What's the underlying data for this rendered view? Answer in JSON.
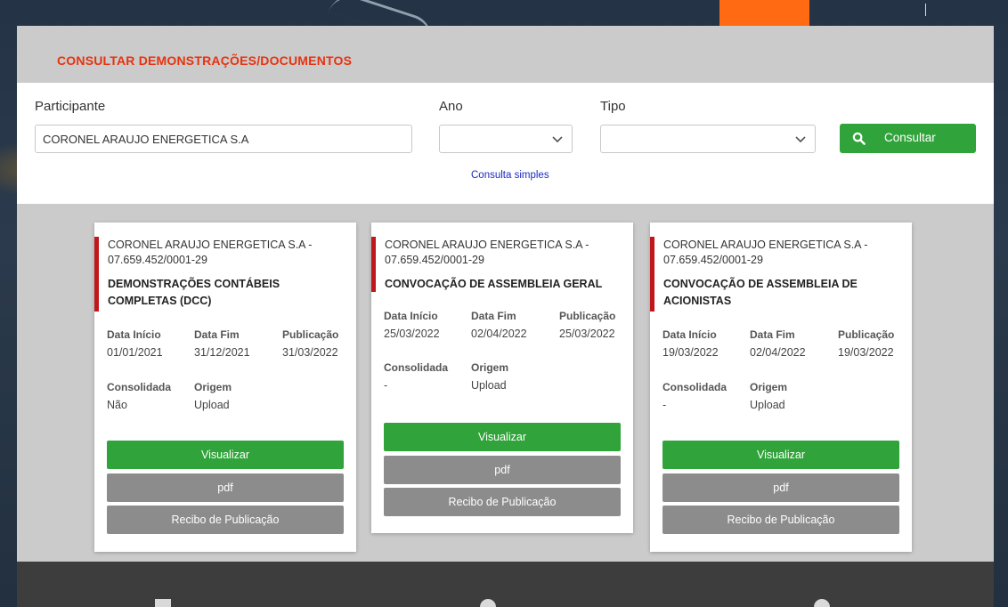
{
  "page": {
    "title": "CONSULTAR DEMONSTRAÇÕES/DOCUMENTOS"
  },
  "filters": {
    "participante_label": "Participante",
    "participante_value": "CORONEL ARAUJO ENERGETICA S.A",
    "ano_label": "Ano",
    "ano_value": "",
    "tipo_label": "Tipo",
    "tipo_value": "",
    "consultar_label": "Consultar",
    "simple_link": "Consulta simples"
  },
  "labels": {
    "data_inicio": "Data Início",
    "data_fim": "Data Fim",
    "publicacao": "Publicação",
    "consolidada": "Consolidada",
    "origem": "Origem",
    "visualizar": "Visualizar",
    "pdf": "pdf",
    "recibo": "Recibo de Publicação"
  },
  "cards": [
    {
      "org_line1": "CORONEL ARAUJO ENERGETICA S.A -",
      "org_line2": "07.659.452/0001-29",
      "type_line1": "DEMONSTRAÇÕES CONTÁBEIS",
      "type_line2": "COMPLETAS (DCC)",
      "data_inicio": "01/01/2021",
      "data_fim": "31/12/2021",
      "publicacao": "31/03/2022",
      "consolidada": "Não",
      "origem": "Upload"
    },
    {
      "org_line1": "CORONEL ARAUJO ENERGETICA S.A -",
      "org_line2": "07.659.452/0001-29",
      "type_line1": "CONVOCAÇÃO DE ASSEMBLEIA GERAL",
      "type_line2": "",
      "data_inicio": "25/03/2022",
      "data_fim": "02/04/2022",
      "publicacao": "25/03/2022",
      "consolidada": "-",
      "origem": "Upload"
    },
    {
      "org_line1": "CORONEL ARAUJO ENERGETICA S.A -",
      "org_line2": "07.659.452/0001-29",
      "type_line1": "CONVOCAÇÃO DE ASSEMBLEIA DE",
      "type_line2": "ACIONISTAS",
      "data_inicio": "19/03/2022",
      "data_fim": "02/04/2022",
      "publicacao": "19/03/2022",
      "consolidada": "-",
      "origem": "Upload"
    }
  ],
  "colors": {
    "title_red": "#e8320e",
    "accent_red": "#c0171c",
    "button_green": "#30a43a",
    "button_gray": "#8c8c8c",
    "brand_orange": "#ff6a13"
  }
}
